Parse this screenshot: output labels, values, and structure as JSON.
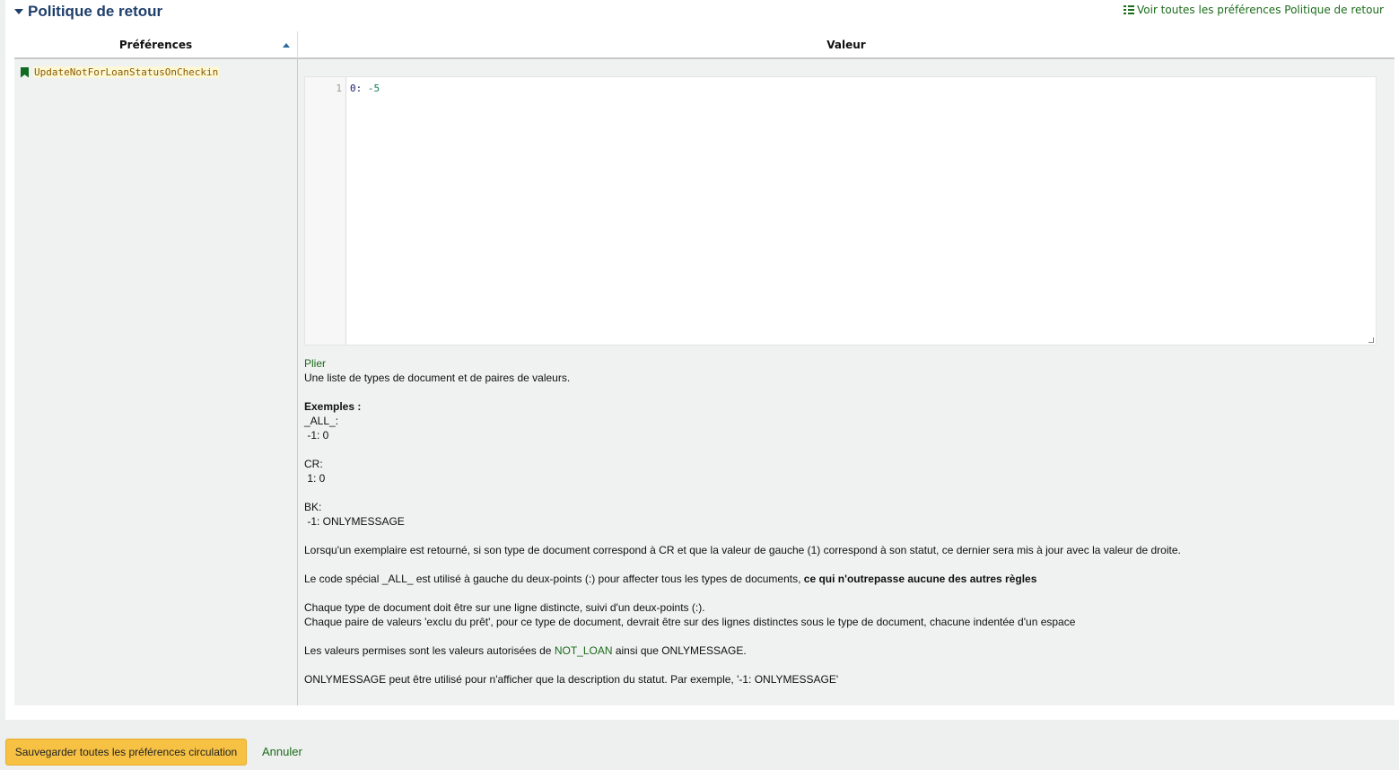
{
  "section": {
    "title": "Politique de retour",
    "view_all": "Voir toutes les préférences Politique de retour"
  },
  "table": {
    "headers": {
      "preferences": "Préférences",
      "value": "Valeur"
    },
    "row": {
      "pref_name": "UpdateNotForLoanStatusOnCheckin",
      "editor": {
        "line_number": "1",
        "key": "0:",
        "value": "-5"
      },
      "collapse_link": "Plier",
      "description": {
        "intro": "Une liste de types de document et de paires de valeurs.",
        "examples_title": "Exemples :",
        "ex1_type": "_ALL_:",
        "ex1_pair": " -1: 0",
        "ex2_type": "CR:",
        "ex2_pair": " 1: 0",
        "ex3_type": "BK:",
        "ex3_pair": " -1: ONLYMESSAGE",
        "para1": "Lorsqu'un exemplaire est retourné, si son type de document correspond à CR et que la valeur de gauche (1) correspond à son statut, ce dernier sera mis à jour avec la valeur de droite.",
        "para2_start": "Le code spécial _ALL_ est utilisé à gauche du deux-points (:) pour affecter tous les types de documents, ",
        "para2_bold": "ce qui n'outrepasse aucune des autres règles",
        "para3_line1": "Chaque type de document doit être sur une ligne distincte, suivi d'un deux-points (:).",
        "para3_line2": "Chaque paire de valeurs 'exclu du prêt', pour ce type de document, devrait être sur des lignes distinctes sous le type de document, chacune indentée d'un espace",
        "para4_start": "Les valeurs permises sont les valeurs autorisées de ",
        "para4_link": "NOT_LOAN",
        "para4_end": " ainsi que ONLYMESSAGE.",
        "para5": "ONLYMESSAGE peut être utilisé pour n'afficher que la description du statut. Par exemple, '-1: ONLYMESSAGE'"
      }
    }
  },
  "footer": {
    "save_label": "Sauvegarder toutes les préférences circulation",
    "cancel_label": "Annuler"
  },
  "colors": {
    "accent_green": "#1a6b1a",
    "save_button": "#f7c244",
    "title_blue": "#1f3f6b"
  }
}
